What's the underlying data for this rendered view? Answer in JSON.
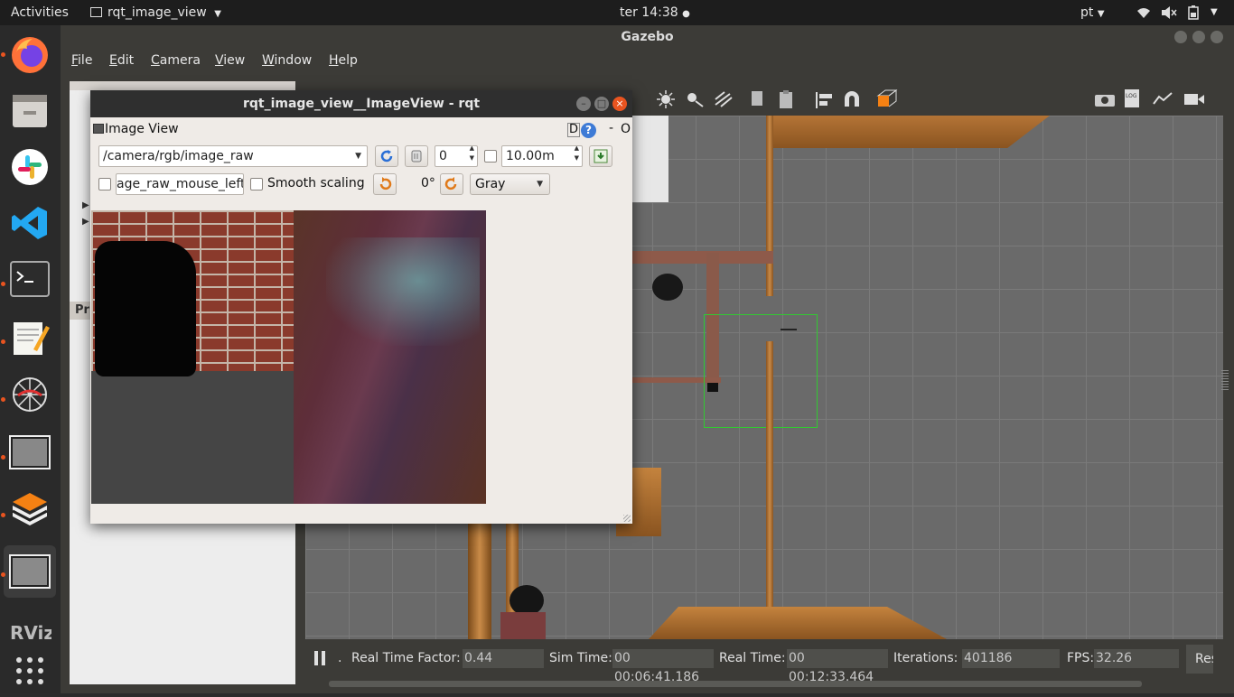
{
  "topbar": {
    "activities": "Activities",
    "app_name": "rqt_image_view",
    "clock": "ter 14:38",
    "lang": "pt"
  },
  "gazebo": {
    "title": "Gazebo",
    "menu": [
      "File",
      "Edit",
      "Camera",
      "View",
      "Window",
      "Help"
    ],
    "left_panel_text": "Pr",
    "status": {
      "pause_dot": ".",
      "rtf_label": "Real Time Factor:",
      "rtf_value": "0.44",
      "sim_label": "Sim Time:",
      "sim_value": "00 00:06:41.186",
      "real_label": "Real Time:",
      "real_value": "00 00:12:33.464",
      "iter_label": "Iterations:",
      "iter_value": "401186",
      "fps_label": "FPS:",
      "fps_value": "32.26",
      "reset_label": "Res"
    }
  },
  "rqt": {
    "title": "rqt_image_view__ImageView - rqt",
    "plugin_title": "Image View",
    "plugin_d": "D",
    "plugin_help": "?",
    "plugin_dash": "-",
    "plugin_o": "O",
    "topic": "/camera/rgb/image_raw",
    "spin_value": "0",
    "duration": "10.00m",
    "mouse_topic": "age_raw_mouse_left",
    "smooth_label": "Smooth scaling",
    "rotation": "0°",
    "color_scheme": "Gray"
  },
  "colors": {
    "ubuntu_orange": "#e95420",
    "gazebo_bg": "#3c3b37",
    "rqt_bg": "#efebe7",
    "select_box": "#32c832"
  }
}
